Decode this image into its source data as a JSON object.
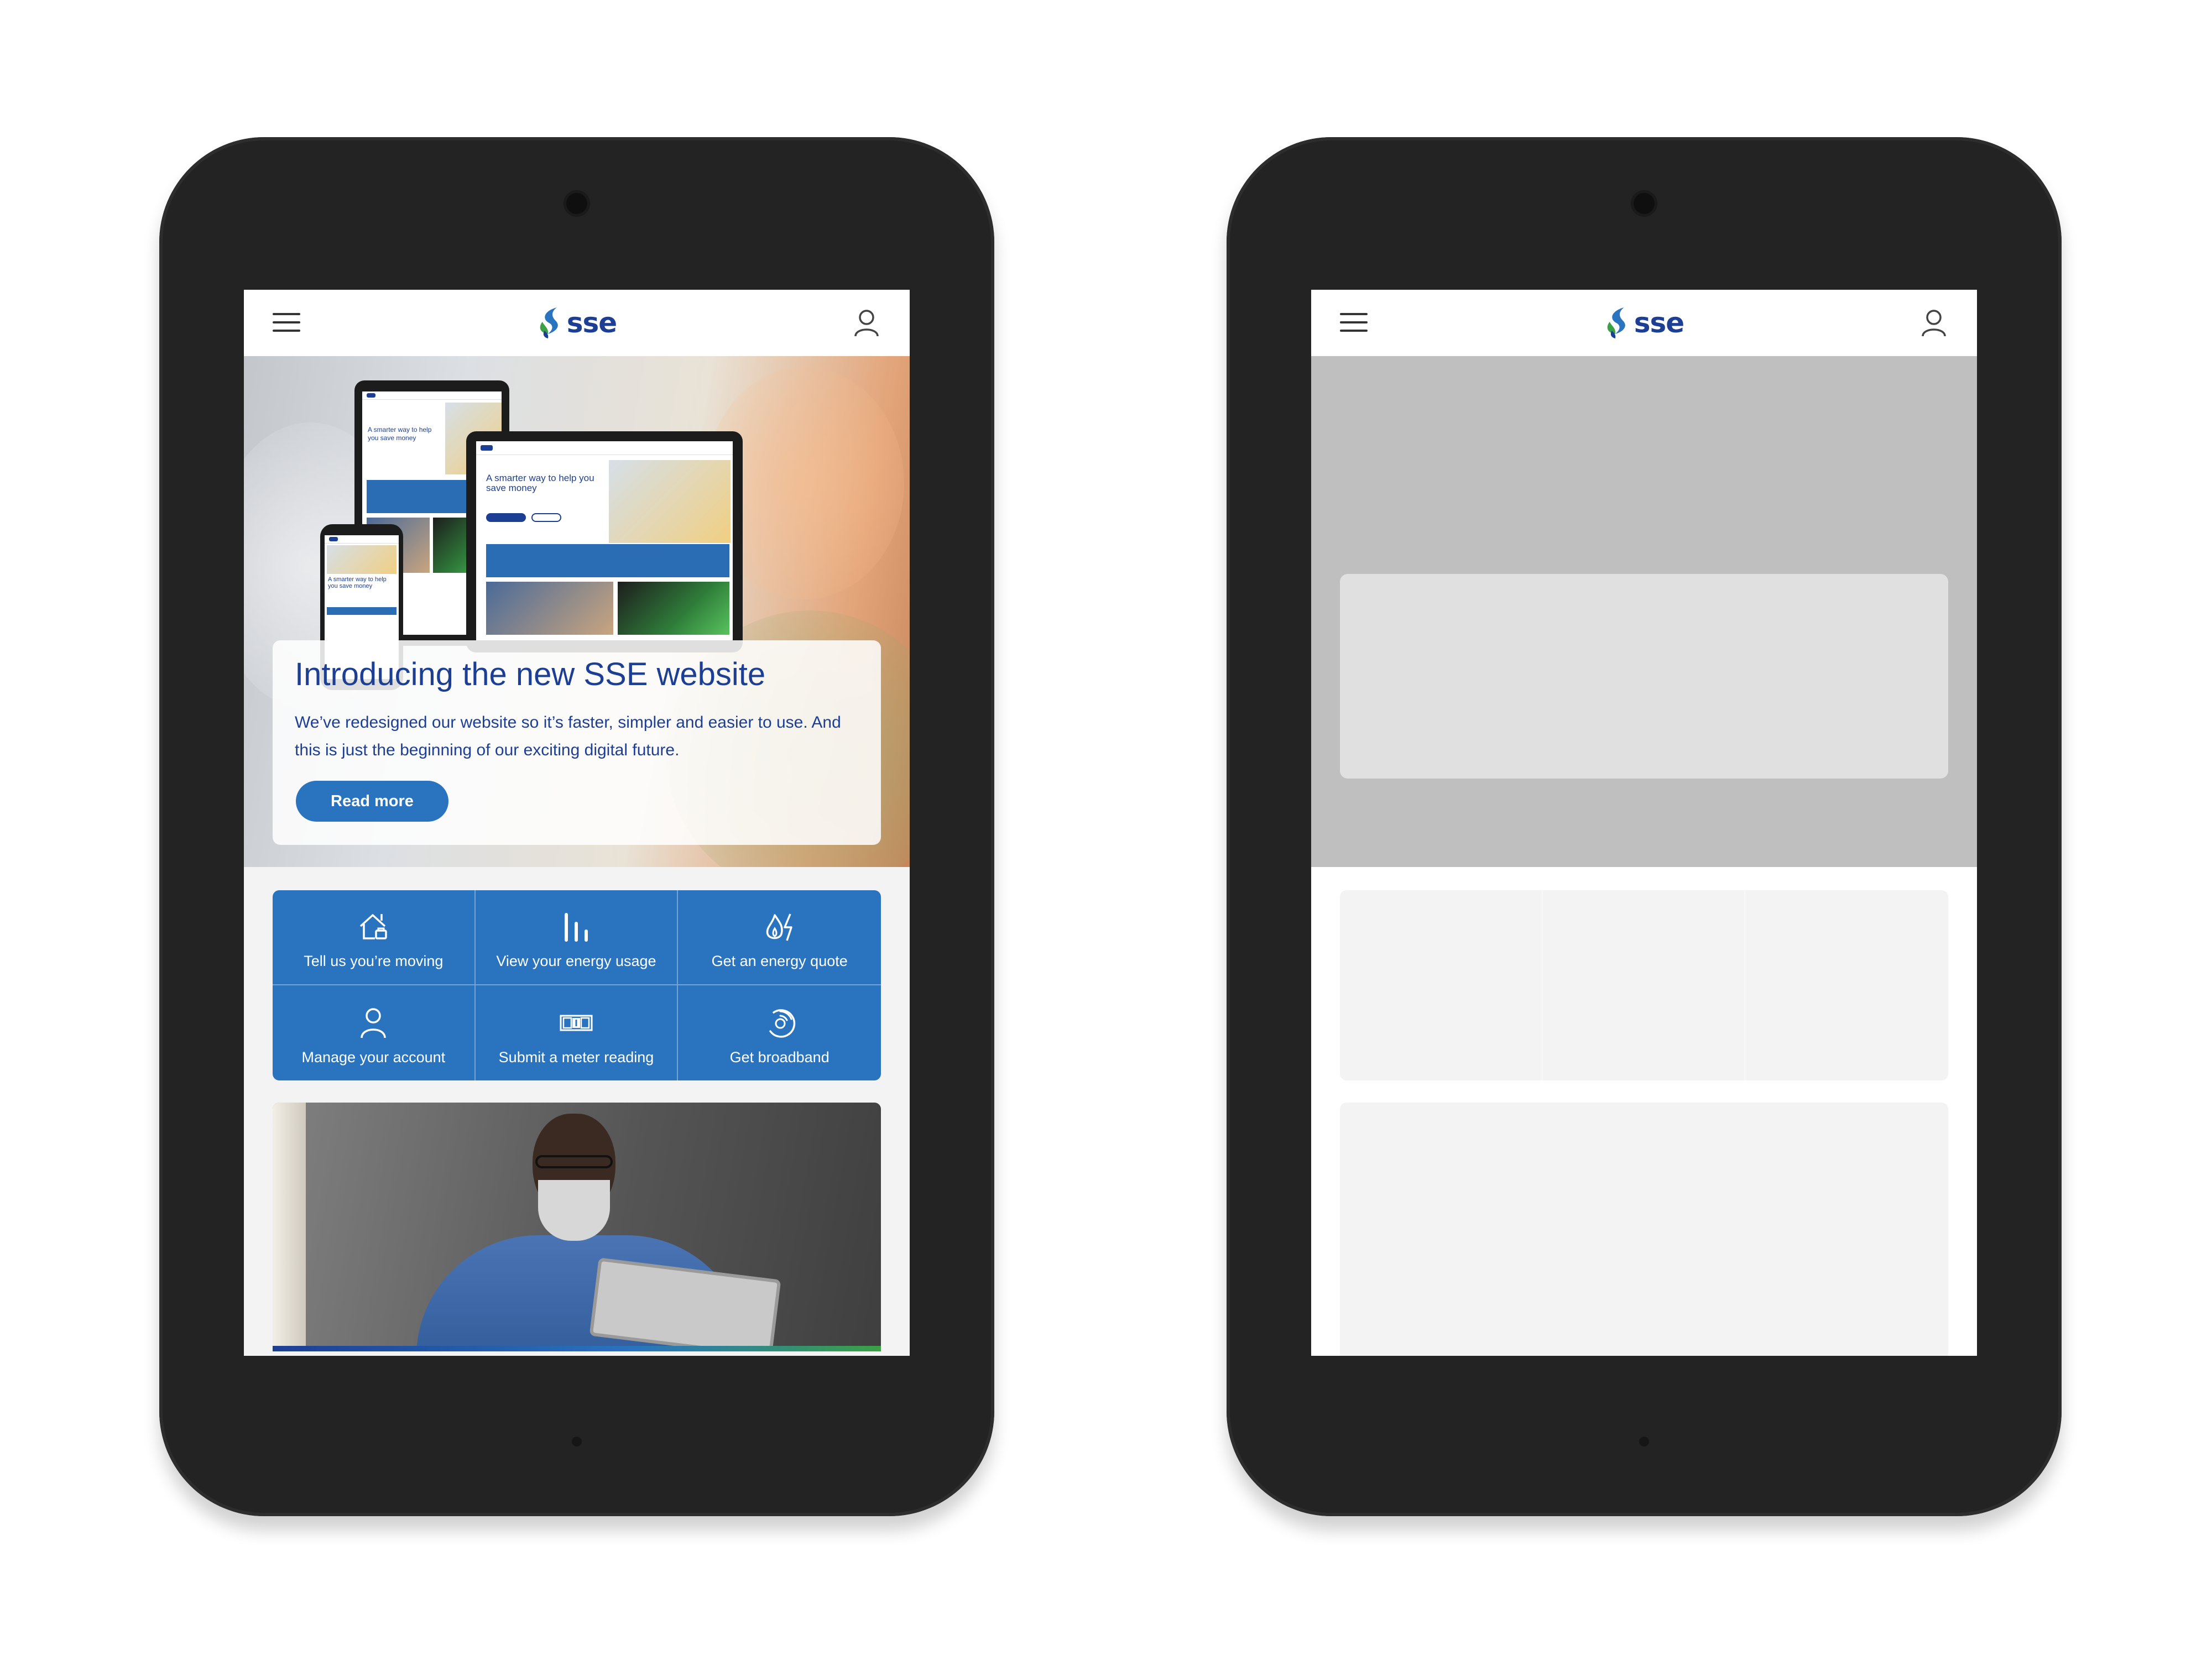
{
  "brand": {
    "logo_text": "sse",
    "logo_colors": {
      "primary": "#1c3f94",
      "leaf_green": "#3aa145",
      "leaf_blue": "#2a74bf"
    }
  },
  "header": {
    "menu_icon": "hamburger-menu-icon",
    "account_icon": "user-account-icon"
  },
  "hero": {
    "title": "Introducing the new SSE website",
    "description": "We’ve redesigned our website so it’s faster, simpler and easier to use. And this is just the beginning of our exciting digital future.",
    "cta_label": "Read more"
  },
  "mockup": {
    "headline": "A smarter way to help you save money"
  },
  "quick_links": [
    {
      "label": "Tell us you’re moving",
      "icon": "house-move-icon"
    },
    {
      "label": "View your energy usage",
      "icon": "bar-chart-icon"
    },
    {
      "label": "Get an energy quote",
      "icon": "flame-bolt-icon"
    },
    {
      "label": "Manage your account",
      "icon": "user-account-icon"
    },
    {
      "label": "Submit a meter reading",
      "icon": "meter-counter-icon"
    },
    {
      "label": "Get broadband",
      "icon": "broadband-router-icon"
    }
  ],
  "colors": {
    "accent": "#2a74bf",
    "title_blue": "#1c3f94",
    "skeleton_dark": "#bfbfbf",
    "skeleton_light": "#f3f3f3"
  }
}
